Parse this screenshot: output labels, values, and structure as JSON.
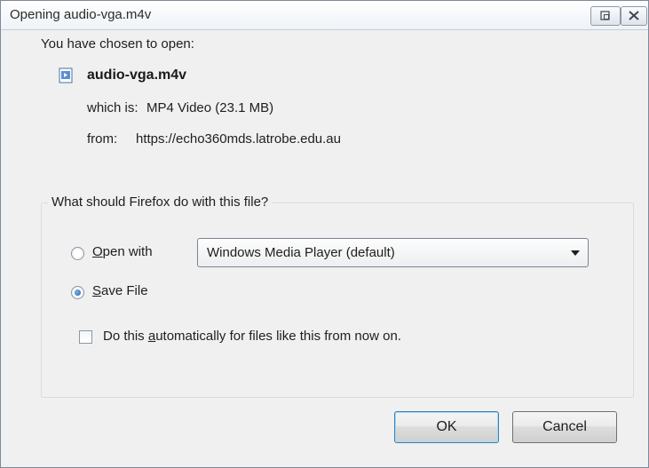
{
  "window": {
    "title": "Opening audio-vga.m4v"
  },
  "dialog": {
    "intro": "You have chosen to open:",
    "file_name": "audio-vga.m4v",
    "which_is_label": "which is:",
    "which_is_value": "MP4 Video (23.1 MB)",
    "from_label": "from:",
    "from_value": "https://echo360mds.latrobe.edu.au"
  },
  "action_group": {
    "legend": "What should Firefox do with this file?",
    "open_with": {
      "mnemonic": "O",
      "rest": "pen with",
      "selected": false
    },
    "open_with_app": "Windows Media Player (default)",
    "save_file": {
      "mnemonic": "S",
      "rest": "ave File",
      "selected": true
    },
    "auto": {
      "before": "Do this ",
      "mnemonic": "a",
      "after": "utomatically for files like this from now on.",
      "checked": false
    }
  },
  "buttons": {
    "ok": "OK",
    "cancel": "Cancel"
  },
  "icons": {
    "restore": "restore-icon",
    "close": "close-icon",
    "file": "media-file-icon"
  }
}
